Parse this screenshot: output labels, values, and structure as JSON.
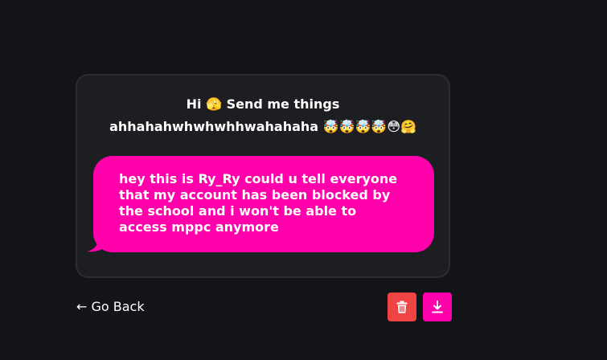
{
  "card": {
    "prompt_line1": "Hi 🫣 Send me things",
    "prompt_line2": "ahhahahwhwhwhhwahahaha 🤯🤯🤯🤯😳🤗"
  },
  "message": {
    "text": "hey this is Ry_Ry could u tell everyone that my account has been blocked by the school and i won't be able to access mppc anymore"
  },
  "nav": {
    "back_label": "← Go Back"
  },
  "actions": {
    "delete_icon": "trash-icon",
    "download_icon": "download-icon"
  },
  "colors": {
    "background": "#131417",
    "card": "#1d1e22",
    "accent": "#ff00aa",
    "danger": "#ef4444"
  }
}
